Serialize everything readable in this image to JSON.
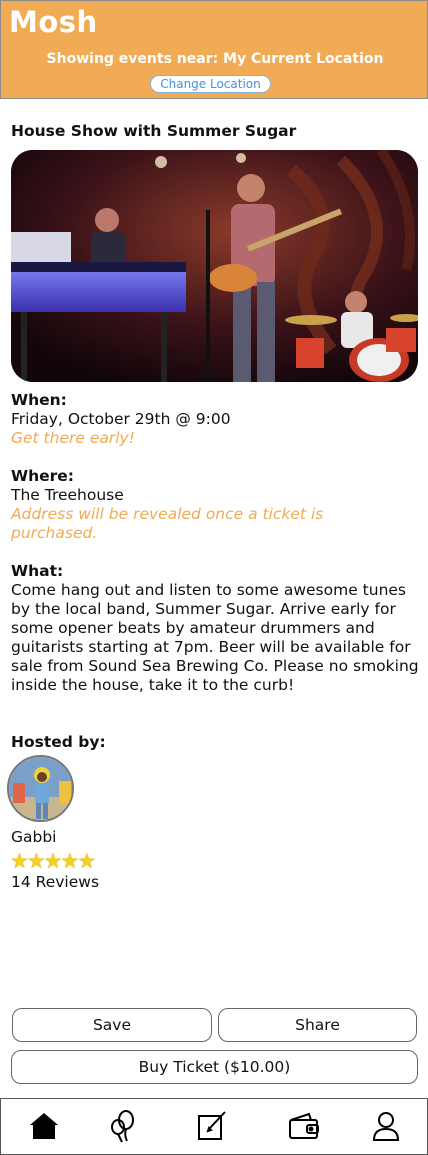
{
  "header": {
    "app_title": "Mosh",
    "location_text": "Showing events near: My Current Location",
    "change_location_label": "Change Location",
    "accent_color": "#f0ab54"
  },
  "event": {
    "title": "House Show with Summer Sugar",
    "photo_icon": "band-performance-photo",
    "when_label": "When:",
    "when_value": "Friday, October 29th @ 9:00",
    "when_note": "Get there early!",
    "where_label": "Where:",
    "where_value": "The Treehouse",
    "where_note": "Address will be revealed once a ticket is purchased.",
    "what_label": "What:",
    "what_value": "Come hang out and listen to some awesome tunes  by the local band, Summer Sugar. Arrive early for some opener beats by amateur drummers and guitarists starting at 7pm. Beer will be available for sale from Sound Sea Brewing Co. Please no smoking inside the house, take it to the curb!"
  },
  "host": {
    "label": "Hosted by:",
    "name": "Gabbi",
    "rating_stars": 5,
    "reviews": "14 Reviews"
  },
  "actions": {
    "save_label": "Save",
    "share_label": "Share",
    "buy_label": "Buy Ticket ($10.00)"
  },
  "tabbar": {
    "items": [
      "home-icon",
      "balloons-icon",
      "edit-icon",
      "wallet-icon",
      "profile-icon"
    ]
  }
}
